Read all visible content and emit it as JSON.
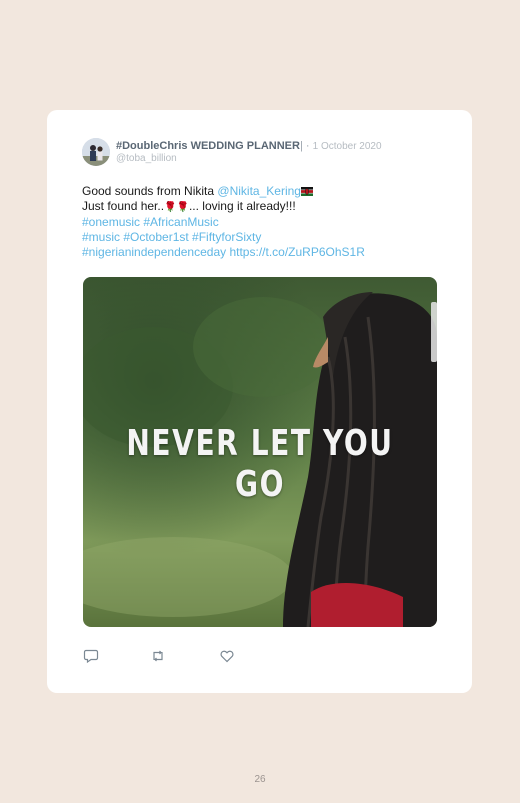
{
  "tweet": {
    "author_name": "#DoubleChris WEDDING PLANNER",
    "separator": "| · ",
    "date": "1 October 2020",
    "handle": "@toba_billion",
    "text_part1": "Good sounds from Nikita ",
    "mention": "@Nikita_Kering",
    "text_line2_start": "Just found her..",
    "text_line2_end": "... loving it already!!!",
    "hashtags_line1": "#onemusic #AfricanMusic",
    "hashtags_line2": "#music #October1st #FiftyforSixty",
    "hashtags_line3": "#nigerianindependenceday",
    "link": "https://t.co/ZuRP6OhS1R",
    "video_caption": "NEVER LET YOU GO"
  },
  "icons": {
    "reply": "reply-icon",
    "retweet": "retweet-icon",
    "like": "heart-icon",
    "flag": "kenya-flag-icon",
    "rose": "rose-icon"
  },
  "colors": {
    "background": "#f2e7de",
    "link": "#5fb6e4",
    "muted": "#b6bcc2"
  },
  "page": {
    "number": "26"
  }
}
